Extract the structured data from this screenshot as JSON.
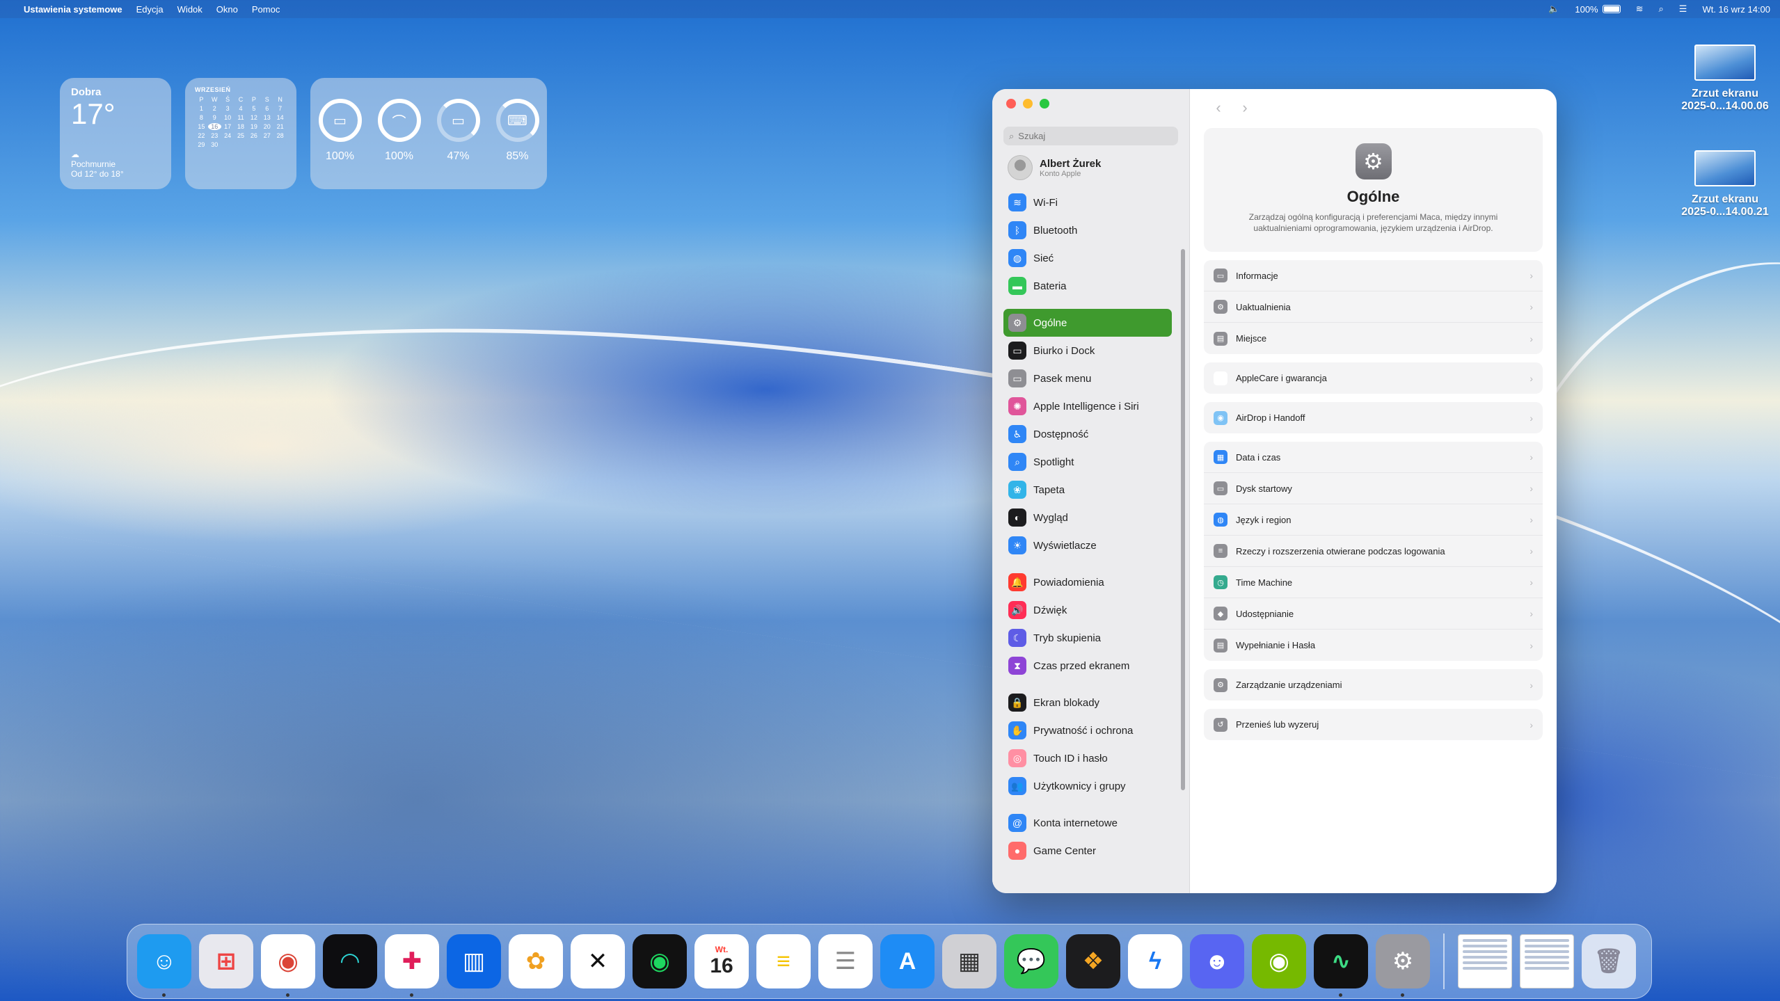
{
  "menubar": {
    "app_name": "Ustawienia systemowe",
    "menus": [
      "Edycja",
      "Widok",
      "Okno",
      "Pomoc"
    ],
    "battery_pct": "100%",
    "datetime": "Wt. 16 wrz 14:00"
  },
  "weather": {
    "city": "Dobra",
    "temp": "17°",
    "condition": "Pochmurnie",
    "range": "Od 12° do 18°"
  },
  "calendar": {
    "month": "WRZESIEŃ",
    "weekdays": [
      "P",
      "W",
      "Ś",
      "C",
      "P",
      "S",
      "N"
    ],
    "today": "16",
    "days": [
      "1",
      "2",
      "3",
      "4",
      "5",
      "6",
      "7",
      "8",
      "9",
      "10",
      "11",
      "12",
      "13",
      "14",
      "15",
      "16",
      "17",
      "18",
      "19",
      "20",
      "21",
      "22",
      "23",
      "24",
      "25",
      "26",
      "27",
      "28",
      "29",
      "30"
    ]
  },
  "batteries": [
    {
      "icon": "laptop-icon",
      "pct": "100%",
      "level": 1.0
    },
    {
      "icon": "airpods-icon",
      "pct": "100%",
      "level": 1.0
    },
    {
      "icon": "case-icon",
      "pct": "47%",
      "level": 0.47
    },
    {
      "icon": "keyboard-icon",
      "pct": "85%",
      "level": 0.85
    }
  ],
  "desktop_files": [
    {
      "line1": "Zrzut ekranu",
      "line2": "2025-0...14.00.06"
    },
    {
      "line1": "Zrzut ekranu",
      "line2": "2025-0...14.00.21"
    }
  ],
  "sidebar": {
    "search_placeholder": "Szukaj",
    "account_name": "Albert Żurek",
    "account_sub": "Konto Apple",
    "items": [
      {
        "label": "Wi-Fi",
        "icon": "wifi-icon",
        "color": "#2f86f6",
        "glyph": "≋"
      },
      {
        "label": "Bluetooth",
        "icon": "bluetooth-icon",
        "color": "#2f86f6",
        "glyph": "ᛒ"
      },
      {
        "label": "Sieć",
        "icon": "globe-icon",
        "color": "#2f86f6",
        "glyph": "◍"
      },
      {
        "label": "Bateria",
        "icon": "battery-icon",
        "color": "#34c759",
        "glyph": "▬",
        "gap_after": true
      },
      {
        "label": "Ogólne",
        "icon": "gear-icon",
        "color": "#8e8e93",
        "glyph": "⚙",
        "active": true
      },
      {
        "label": "Biurko i Dock",
        "icon": "dock-icon",
        "color": "#1c1c1e",
        "glyph": "▭"
      },
      {
        "label": "Pasek menu",
        "icon": "menubar-icon",
        "color": "#8e8e93",
        "glyph": "▭"
      },
      {
        "label": "Apple Intelligence i Siri",
        "icon": "siri-icon",
        "color": "#e0559a",
        "glyph": "✺"
      },
      {
        "label": "Dostępność",
        "icon": "accessibility-icon",
        "color": "#2f86f6",
        "glyph": "♿"
      },
      {
        "label": "Spotlight",
        "icon": "spotlight-icon",
        "color": "#2f86f6",
        "glyph": "⌕"
      },
      {
        "label": "Tapeta",
        "icon": "wallpaper-icon",
        "color": "#32b4e8",
        "glyph": "❀"
      },
      {
        "label": "Wygląd",
        "icon": "appearance-icon",
        "color": "#1c1c1e",
        "glyph": "◐"
      },
      {
        "label": "Wyświetlacze",
        "icon": "displays-icon",
        "color": "#2f86f6",
        "glyph": "☀",
        "gap_after": true
      },
      {
        "label": "Powiadomienia",
        "icon": "notifications-icon",
        "color": "#ff3b30",
        "glyph": "🔔"
      },
      {
        "label": "Dźwięk",
        "icon": "sound-icon",
        "color": "#ff2d55",
        "glyph": "🔊"
      },
      {
        "label": "Tryb skupienia",
        "icon": "focus-icon",
        "color": "#5e5ce6",
        "glyph": "☾"
      },
      {
        "label": "Czas przed ekranem",
        "icon": "screentime-icon",
        "color": "#8e44d6",
        "glyph": "⧗",
        "gap_after": true
      },
      {
        "label": "Ekran blokady",
        "icon": "lock-icon",
        "color": "#1c1c1e",
        "glyph": "🔒"
      },
      {
        "label": "Prywatność i ochrona",
        "icon": "privacy-icon",
        "color": "#2f86f6",
        "glyph": "✋"
      },
      {
        "label": "Touch ID i hasło",
        "icon": "fingerprint-icon",
        "color": "#ff8fa3",
        "glyph": "◎"
      },
      {
        "label": "Użytkownicy i grupy",
        "icon": "users-icon",
        "color": "#2f86f6",
        "glyph": "👥",
        "gap_after": true
      },
      {
        "label": "Konta internetowe",
        "icon": "at-icon",
        "color": "#2f86f6",
        "glyph": "@"
      },
      {
        "label": "Game Center",
        "icon": "gamecenter-icon",
        "color": "#ff6b6b",
        "glyph": "●"
      }
    ]
  },
  "content": {
    "title": "Ogólne",
    "description": "Zarządzaj ogólną konfiguracją i preferencjami Maca, między innymi uaktualnieniami oprogramowania, językiem urządzenia i AirDrop.",
    "groups": [
      [
        {
          "label": "Informacje",
          "icon": "info-icon",
          "color": "#8e8e93",
          "glyph": "▭"
        },
        {
          "label": "Uaktualnienia",
          "icon": "update-icon",
          "color": "#8e8e93",
          "glyph": "⚙"
        },
        {
          "label": "Miejsce",
          "icon": "storage-icon",
          "color": "#8e8e93",
          "glyph": "▤"
        }
      ],
      [
        {
          "label": "AppleCare i gwarancja",
          "icon": "applecare-icon",
          "color": "#ffffff",
          "glyph": "",
          "glyph_color": "#ff3b30"
        }
      ],
      [
        {
          "label": "AirDrop i Handoff",
          "icon": "airdrop-icon",
          "color": "#7fc3f5",
          "glyph": "◉"
        }
      ],
      [
        {
          "label": "Data i czas",
          "icon": "calendar-icon",
          "color": "#2f86f6",
          "glyph": "▦"
        },
        {
          "label": "Dysk startowy",
          "icon": "disk-icon",
          "color": "#8e8e93",
          "glyph": "▭"
        },
        {
          "label": "Język i region",
          "icon": "language-icon",
          "color": "#2f86f6",
          "glyph": "◍"
        },
        {
          "label": "Rzeczy i rozszerzenia otwierane podczas logowania",
          "icon": "login-items-icon",
          "color": "#8e8e93",
          "glyph": "≡"
        },
        {
          "label": "Time Machine",
          "icon": "timemachine-icon",
          "color": "#34aa8e",
          "glyph": "◷"
        },
        {
          "label": "Udostępnianie",
          "icon": "sharing-icon",
          "color": "#8e8e93",
          "glyph": "◆"
        },
        {
          "label": "Wypełnianie i Hasła",
          "icon": "passwords-icon",
          "color": "#8e8e93",
          "glyph": "▤"
        }
      ],
      [
        {
          "label": "Zarządzanie urządzeniami",
          "icon": "device-management-icon",
          "color": "#8e8e93",
          "glyph": "⚙"
        }
      ],
      [
        {
          "label": "Przenieś lub wyzeruj",
          "icon": "reset-icon",
          "color": "#8e8e93",
          "glyph": "↺"
        }
      ]
    ]
  },
  "dock": {
    "apps": [
      {
        "name": "finder",
        "icon": "finder-icon",
        "color": "#1e9bf0",
        "glyph": "☺",
        "running": true
      },
      {
        "name": "launchpad",
        "icon": "launchpad-icon",
        "color": "#e8e8ee",
        "glyph": "⊞",
        "glyph_color": "#e44"
      },
      {
        "name": "chrome",
        "icon": "chrome-icon",
        "color": "#ffffff",
        "glyph": "◉",
        "glyph_color": "#db4437",
        "running": true
      },
      {
        "name": "shazam",
        "icon": "shazam-icon",
        "color": "#0d0d10",
        "glyph": "◠",
        "glyph_color": "#2dd4d4"
      },
      {
        "name": "slack",
        "icon": "slack-icon",
        "color": "#ffffff",
        "glyph": "✚",
        "glyph_color": "#e01e5a",
        "running": true
      },
      {
        "name": "trello",
        "icon": "trello-icon",
        "color": "#0c66e4",
        "glyph": "▥"
      },
      {
        "name": "photos",
        "icon": "photos-icon",
        "color": "#ffffff",
        "glyph": "✿",
        "glyph_color": "#f0a020"
      },
      {
        "name": "capcut",
        "icon": "capcut-icon",
        "color": "#ffffff",
        "glyph": "✕",
        "glyph_color": "#111"
      },
      {
        "name": "spotify",
        "icon": "spotify-icon",
        "color": "#111111",
        "glyph": "◉",
        "glyph_color": "#1ed760"
      },
      {
        "name": "calendar",
        "icon": "calendar-app-icon",
        "color": "#ffffff",
        "glyph": "16",
        "glyph_color": "#222",
        "label_top": "Wt."
      },
      {
        "name": "notes",
        "icon": "notes-icon",
        "color": "#ffffff",
        "glyph": "≡",
        "glyph_color": "#f5c400"
      },
      {
        "name": "reminders",
        "icon": "reminders-icon",
        "color": "#ffffff",
        "glyph": "☰",
        "glyph_color": "#888"
      },
      {
        "name": "appstore",
        "icon": "appstore-icon",
        "color": "#1e8cf5",
        "glyph": "A"
      },
      {
        "name": "calculator",
        "icon": "calculator-icon",
        "color": "#d0d0d4",
        "glyph": "▦",
        "glyph_color": "#333"
      },
      {
        "name": "messages",
        "icon": "messages-icon",
        "color": "#34c759",
        "glyph": "💬"
      },
      {
        "name": "figma-mirror",
        "icon": "figma-icon",
        "color": "#1c1c1e",
        "glyph": "❖",
        "glyph_color": "#f5a623"
      },
      {
        "name": "messenger",
        "icon": "messenger-icon",
        "color": "#ffffff",
        "glyph": "ϟ",
        "glyph_color": "#1877f2"
      },
      {
        "name": "discord",
        "icon": "discord-icon",
        "color": "#5865f2",
        "glyph": "☻"
      },
      {
        "name": "geforce-now",
        "icon": "nvidia-icon",
        "color": "#76b900",
        "glyph": "◉"
      },
      {
        "name": "activity-monitor",
        "icon": "activity-monitor-icon",
        "color": "#111111",
        "glyph": "∿",
        "glyph_color": "#3ddc84",
        "running": true
      },
      {
        "name": "system-settings",
        "icon": "settings-app-icon",
        "color": "#9a9aa0",
        "glyph": "⚙",
        "running": true
      }
    ]
  }
}
